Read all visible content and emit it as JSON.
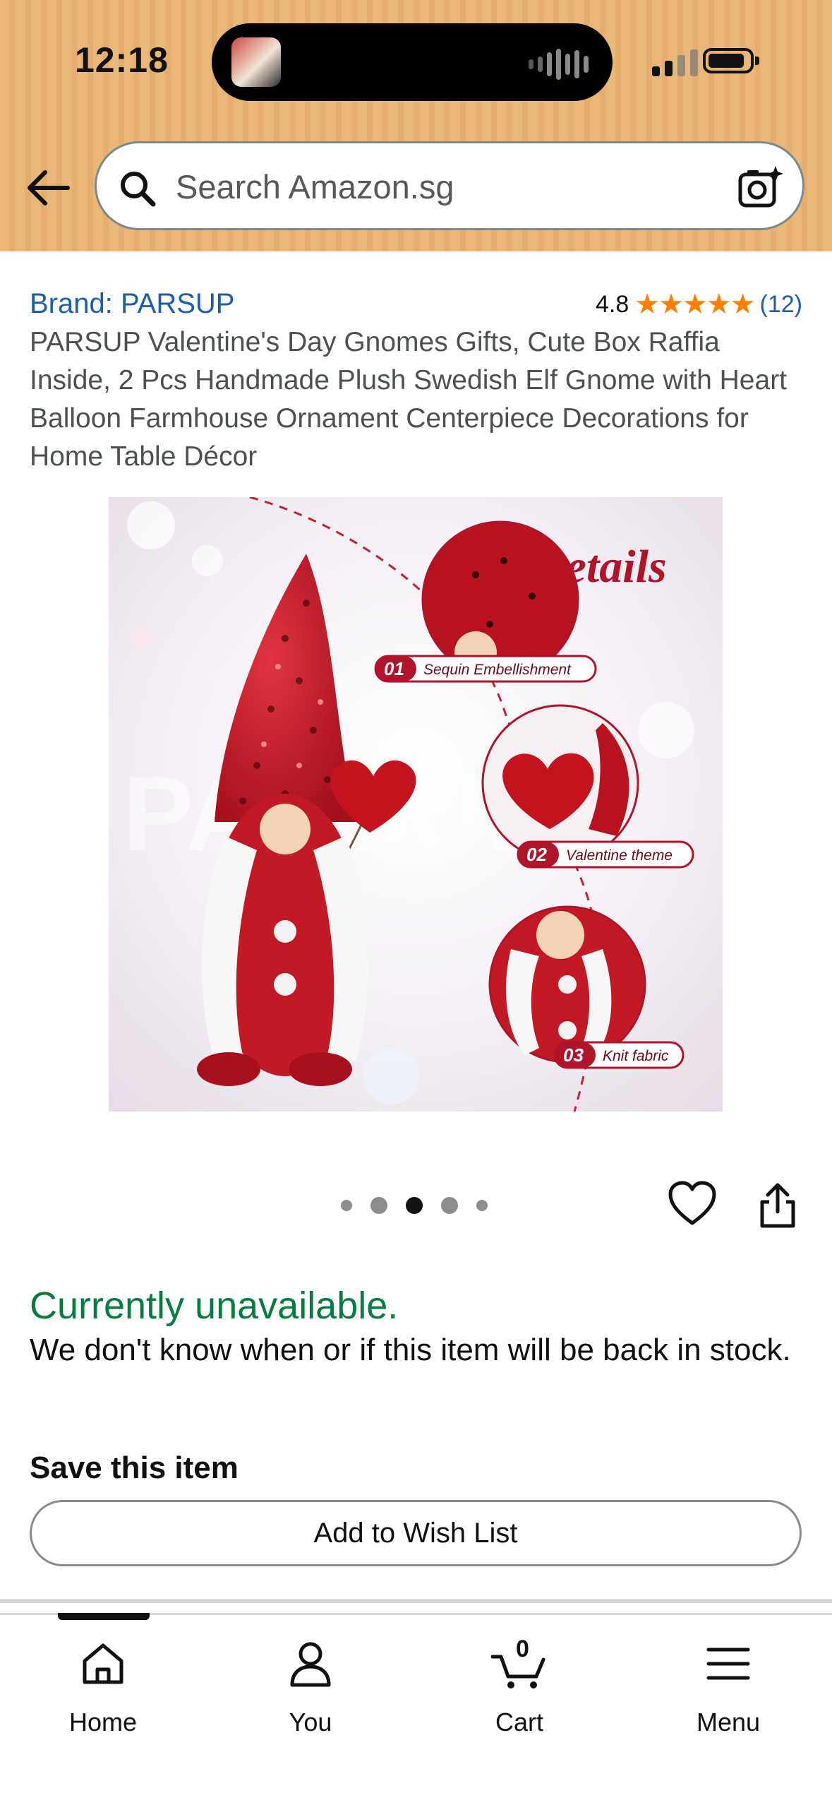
{
  "status_bar": {
    "time": "12:18"
  },
  "search": {
    "placeholder": "Search Amazon.sg"
  },
  "product": {
    "brand": "Brand: PARSUP",
    "rating_value": "4.8",
    "stars": "★★★★★",
    "rating_count": "(12)",
    "title": "PARSUP Valentine's Day Gnomes Gifts, Cute Box Raffia Inside, 2 Pcs Handmade Plush Swedish Elf Gnome with Heart Balloon Farmhouse Ornament Centerpiece Decorations for Home Table Décor"
  },
  "image": {
    "heading": "Details",
    "watermark": "PARSUP",
    "callouts": [
      {
        "number": "01",
        "label": "Sequin Embellishment"
      },
      {
        "number": "02",
        "label": "Valentine theme"
      },
      {
        "number": "03",
        "label": "Knit fabric"
      }
    ]
  },
  "carousel": {
    "total": 5,
    "active_index": 2
  },
  "availability": {
    "status": "Currently unavailable.",
    "message": "We don't know when or if this item will be back in stock."
  },
  "save": {
    "heading": "Save this item",
    "button_label": "Add to Wish List"
  },
  "bottom_nav": {
    "items": [
      {
        "label": "Home",
        "icon": "home-icon",
        "active": true
      },
      {
        "label": "You",
        "icon": "person-icon"
      },
      {
        "label": "Cart",
        "icon": "cart-icon",
        "badge": "0"
      },
      {
        "label": "Menu",
        "icon": "menu-icon"
      }
    ]
  },
  "colors": {
    "header_bg": "#e9b777",
    "link": "#1f5ea8",
    "available_green": "#067d3e",
    "star": "#ff7f00"
  }
}
